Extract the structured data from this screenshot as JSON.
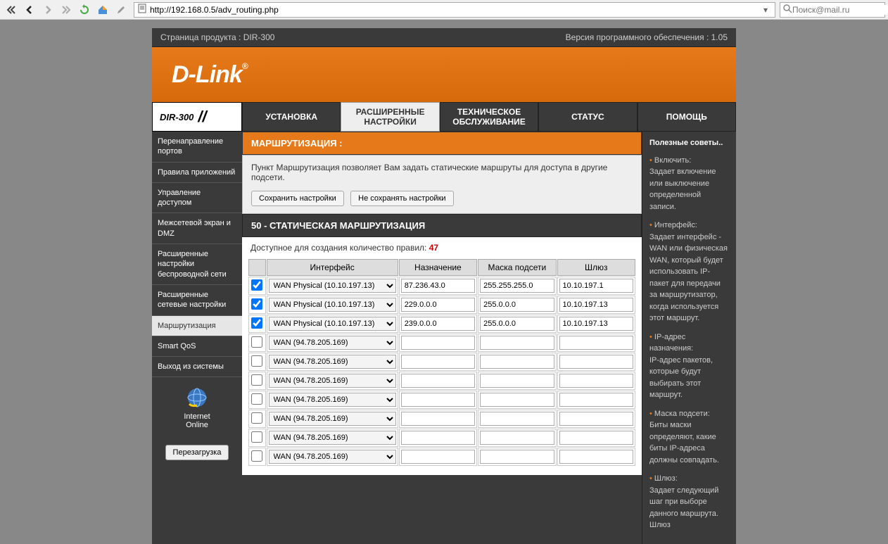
{
  "browser": {
    "url": "http://192.168.0.5/adv_routing.php",
    "search_placeholder": "Поиск@mail.ru"
  },
  "header": {
    "product_page": "Страница продукта :  DIR-300",
    "firmware": "Версия программного обеспечения : 1.05",
    "logo": "D-Link",
    "model": "DIR-300"
  },
  "nav": {
    "tabs": [
      "УСТАНОВКА",
      "РАСШИРЕННЫЕ НАСТРОЙКИ",
      "ТЕХНИЧЕСКОЕ ОБСЛУЖИВАНИЕ",
      "СТАТУС",
      "ПОМОЩЬ"
    ]
  },
  "sidebar": {
    "items": [
      "Перенаправление портов",
      "Правила приложений",
      "Управление доступом",
      "Межсетевой экран и DMZ",
      "Расширенные настройки беспроводной сети",
      "Расширенные сетевые настройки",
      "Маршрутизация",
      "Smart QoS",
      "Выход из системы"
    ],
    "internet_label1": "Internet",
    "internet_label2": "Online",
    "reboot": "Перезагрузка"
  },
  "content": {
    "section_title": "МАРШРУТИЗАЦИЯ :",
    "description": "Пункт Маршрутизация позволяет Вам задать статические маршруты для доступа в другие подсети.",
    "btn_save": "Сохранить настройки",
    "btn_dont_save": "Не сохранять настройки",
    "table_title": "50 - СТАТИЧЕСКАЯ МАРШРУТИЗАЦИЯ",
    "available_text": "Доступное для создания количество правил:",
    "available_count": "47",
    "columns": {
      "iface": "Интерфейс",
      "dest": "Назначение",
      "mask": "Маска подсети",
      "gw": "Шлюз"
    },
    "iface_options": {
      "wan_phys": "WAN Physical (10.10.197.13)",
      "wan": "WAN (94.78.205.169)"
    },
    "rows": [
      {
        "checked": true,
        "iface": "wan_phys",
        "dest": "87.236.43.0",
        "mask": "255.255.255.0",
        "gw": "10.10.197.1"
      },
      {
        "checked": true,
        "iface": "wan_phys",
        "dest": "229.0.0.0",
        "mask": "255.0.0.0",
        "gw": "10.10.197.13"
      },
      {
        "checked": true,
        "iface": "wan_phys",
        "dest": "239.0.0.0",
        "mask": "255.0.0.0",
        "gw": "10.10.197.13"
      },
      {
        "checked": false,
        "iface": "wan",
        "dest": "",
        "mask": "",
        "gw": ""
      },
      {
        "checked": false,
        "iface": "wan",
        "dest": "",
        "mask": "",
        "gw": ""
      },
      {
        "checked": false,
        "iface": "wan",
        "dest": "",
        "mask": "",
        "gw": ""
      },
      {
        "checked": false,
        "iface": "wan",
        "dest": "",
        "mask": "",
        "gw": ""
      },
      {
        "checked": false,
        "iface": "wan",
        "dest": "",
        "mask": "",
        "gw": ""
      },
      {
        "checked": false,
        "iface": "wan",
        "dest": "",
        "mask": "",
        "gw": ""
      },
      {
        "checked": false,
        "iface": "wan",
        "dest": "",
        "mask": "",
        "gw": ""
      }
    ]
  },
  "tips": {
    "title": "Полезные советы..",
    "items": [
      {
        "h": "Включить:",
        "t": "Задает включение или выключение определенной записи."
      },
      {
        "h": "Интерфейс:",
        "t": "Задает интерфейс - WAN или физическая WAN, который будет использовать IP-пакет для передачи за маршрутизатор, когда используется этот маршрут."
      },
      {
        "h": "IP-адрес назначения:",
        "t": "IP-адрес пакетов, которые будут выбирать этот маршрут."
      },
      {
        "h": "Маска подсети:",
        "t": "Биты маски определяют, какие биты IP-адреса должны совпадать."
      },
      {
        "h": "Шлюз:",
        "t": "Задает следующий шаг при выборе данного маршрута. Шлюз"
      }
    ]
  }
}
